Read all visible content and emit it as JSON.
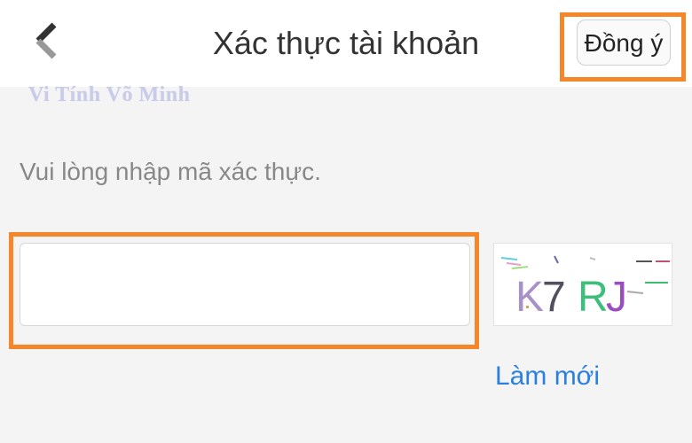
{
  "header": {
    "title": "Xác thực tài khoản",
    "back_icon": "chevron-left-icon",
    "confirm_label": "Đồng ý"
  },
  "watermark": "Vi Tính Võ Minh",
  "form": {
    "prompt": "Vui lòng nhập mã xác thực.",
    "code_value": "",
    "code_placeholder": "",
    "captcha_text": "K7RJ",
    "refresh_label": "Làm mới"
  },
  "colors": {
    "highlight": "#f5862a",
    "link": "#2a7fe0",
    "header_bg": "#ffffff",
    "page_bg": "#f4f4f4"
  }
}
